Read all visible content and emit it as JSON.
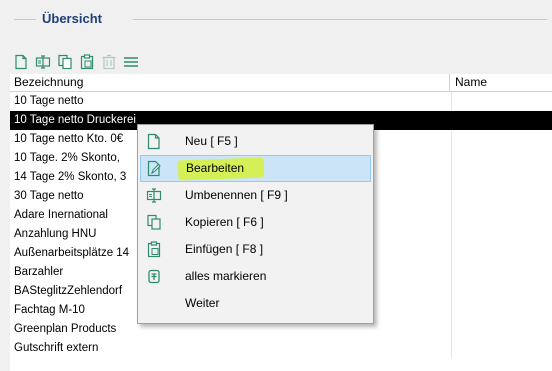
{
  "group": {
    "title": "Übersicht"
  },
  "toolbar": {
    "buttons": [
      {
        "icon": "new-document-icon"
      },
      {
        "icon": "rename-icon"
      },
      {
        "icon": "copy-icon"
      },
      {
        "icon": "paste-icon"
      },
      {
        "icon": "delete-icon"
      },
      {
        "icon": "menu-icon"
      }
    ]
  },
  "grid": {
    "columns": [
      "Bezeichnung",
      "Name"
    ],
    "rows": [
      {
        "bezeichnung": "10 Tage netto",
        "name": ""
      },
      {
        "bezeichnung": "10 Tage netto Druckerei",
        "name": ""
      },
      {
        "bezeichnung": "10 Tage netto Kto. 0€",
        "name": ""
      },
      {
        "bezeichnung": "10 Tage. 2% Skonto, ",
        "name": ""
      },
      {
        "bezeichnung": "14 Tage 2% Skonto, 3",
        "name": ""
      },
      {
        "bezeichnung": "30 Tage netto",
        "name": ""
      },
      {
        "bezeichnung": "Adare Inernational",
        "name": ""
      },
      {
        "bezeichnung": "Anzahlung HNU",
        "name": ""
      },
      {
        "bezeichnung": "Außenarbeitsplätze 14",
        "name": ""
      },
      {
        "bezeichnung": "Barzahler",
        "name": ""
      },
      {
        "bezeichnung": "BASteglitzZehlendorf",
        "name": ""
      },
      {
        "bezeichnung": "Fachtag M-10",
        "name": ""
      },
      {
        "bezeichnung": "Greenplan Products",
        "name": ""
      },
      {
        "bezeichnung": "Gutschrift extern",
        "name": ""
      }
    ],
    "selected_index": 1
  },
  "context_menu": {
    "items": [
      {
        "label": "Neu [ F5 ]",
        "icon": "new-document-icon"
      },
      {
        "label": "Bearbeiten",
        "icon": "edit-document-icon",
        "highlighted": true
      },
      {
        "label": "Umbenennen [ F9 ]",
        "icon": "rename-icon"
      },
      {
        "label": "Kopieren [ F6 ]",
        "icon": "copy-icon"
      },
      {
        "label": "Einfügen [ F8 ]",
        "icon": "paste-icon"
      },
      {
        "label": "alles markieren",
        "icon": "select-all-icon"
      },
      {
        "label": "Weiter",
        "icon": ""
      }
    ]
  },
  "colors": {
    "icon": "#2e8b6f",
    "selection_bg": "#000000",
    "menu_hover_bg": "#cce4f7",
    "marker": "#d6f23a",
    "group_title": "#1f3f7a"
  }
}
